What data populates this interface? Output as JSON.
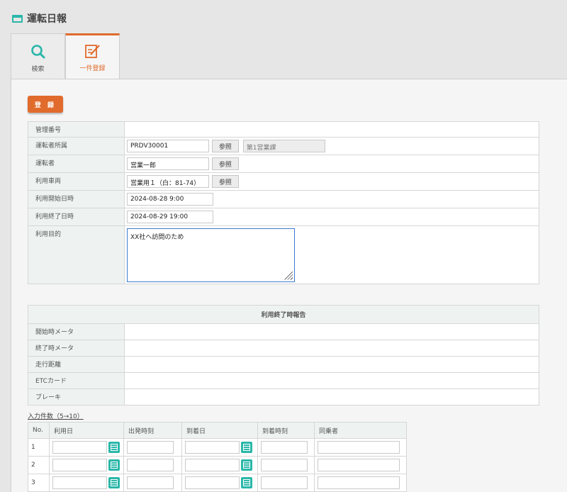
{
  "header": {
    "title": "運転日報"
  },
  "tabs": [
    {
      "label": "検索"
    },
    {
      "label": "一件登録"
    }
  ],
  "register_button": "登 録",
  "form": {
    "management_no": {
      "label": "管理番号",
      "value": ""
    },
    "driver_dept": {
      "label": "運転者所属",
      "value": "PRDV30001",
      "ref_label": "参照",
      "name_value": "第1営業課"
    },
    "driver": {
      "label": "運転者",
      "value": "営業一郎",
      "ref_label": "参照"
    },
    "vehicle": {
      "label": "利用車両",
      "value": "営業用１（白：81-74）",
      "ref_label": "参照"
    },
    "start_datetime": {
      "label": "利用開始日時",
      "value": "2024-08-28 9:00"
    },
    "end_datetime": {
      "label": "利用終了日時",
      "value": "2024-08-29 19:00"
    },
    "purpose": {
      "label": "利用目的",
      "value": "XX社へ訪問のため"
    }
  },
  "report": {
    "title": "利用終了時報告",
    "fields": [
      {
        "label": "開始時メータ",
        "value": ""
      },
      {
        "label": "終了時メータ",
        "value": ""
      },
      {
        "label": "走行距離",
        "value": ""
      },
      {
        "label": "ETCカード",
        "value": ""
      },
      {
        "label": "ブレーキ",
        "value": ""
      }
    ]
  },
  "input_count_label": "入力件数（5→10）",
  "rows_table": {
    "columns": [
      "No.",
      "利用日",
      "出発時刻",
      "到着日",
      "到着時刻",
      "同乗者"
    ],
    "rows": [
      {
        "no": "1"
      },
      {
        "no": "2"
      },
      {
        "no": "3"
      }
    ]
  },
  "colors": {
    "accent": "#e06b2c",
    "teal": "#2ab7a9",
    "label_bg": "#eef3f2"
  },
  "icons": {
    "search_tab": "search-icon",
    "register_tab": "edit-icon",
    "calendar": "calendar-icon"
  }
}
